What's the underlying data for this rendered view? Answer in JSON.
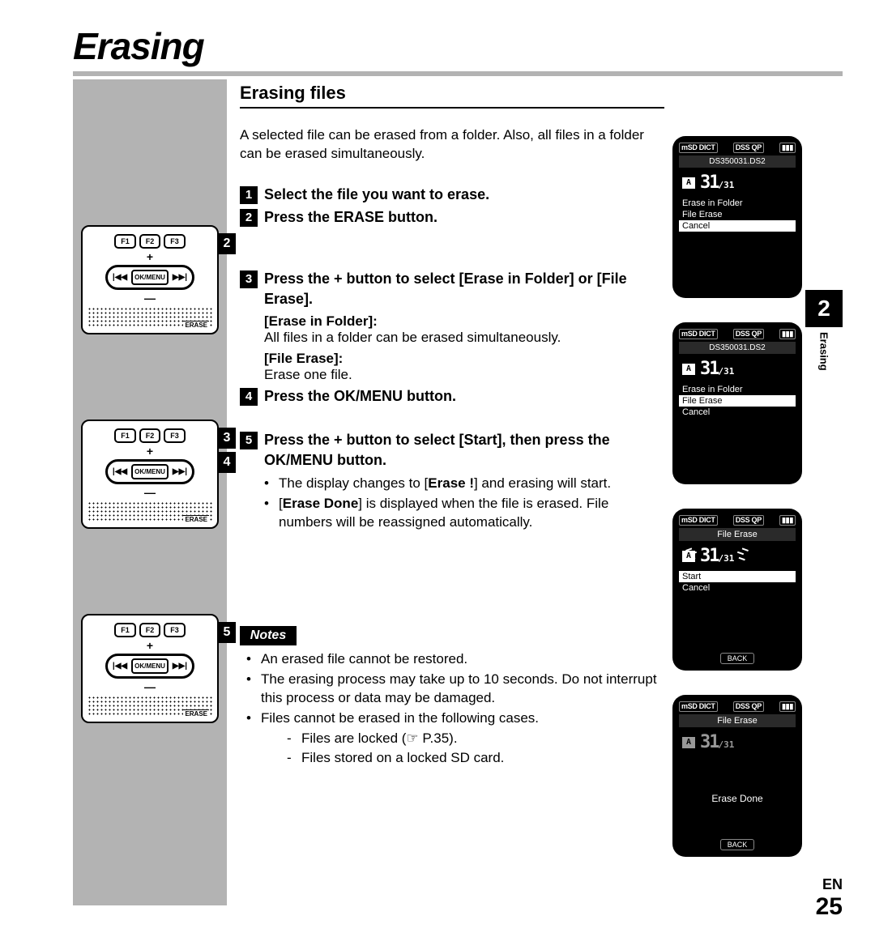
{
  "chapter_title": "Erasing",
  "section_title": "Erasing files",
  "intro": "A selected file can be erased from a folder. Also, all files in a folder can be erased simultaneously.",
  "steps": {
    "s1": "Select the file you want to erase.",
    "s2": "Press the ERASE button.",
    "s3": "Press the + button to select [Erase in Folder] or [File Erase].",
    "s3_sub1_label": "[Erase in Folder]:",
    "s3_sub1_text": "All files in a folder can be erased simultaneously.",
    "s3_sub2_label": "[File Erase]:",
    "s3_sub2_text": "Erase one file.",
    "s4": "Press the OK/MENU button.",
    "s5": "Press the + button to select [Start], then press the OK/MENU button.",
    "s5_b1_pre": "The display changes to [",
    "s5_b1_bold": "Erase !",
    "s5_b1_post": "] and erasing will start.",
    "s5_b2_pre": "[",
    "s5_b2_bold": "Erase Done",
    "s5_b2_post": "] is displayed when the file is erased. File numbers will be reassigned automatically."
  },
  "notes_label": "Notes",
  "notes": {
    "n1": "An erased file cannot be restored.",
    "n2": "The erasing process may take up to 10 seconds. Do not interrupt this process or data may be damaged.",
    "n3": "Files cannot be erased in the following cases.",
    "n3a": "Files are locked (☞ P.35).",
    "n3b": "Files stored on a locked SD card."
  },
  "device": {
    "f1": "F1",
    "f2": "F2",
    "f3": "F3",
    "rew": "|◀◀",
    "okmenu": "OK/MENU",
    "ff": "▶▶|",
    "plus": "+",
    "minus": "—",
    "erase": "ERASE"
  },
  "screens": {
    "status_left": "mSD DICT",
    "status_mid": "DSS QP",
    "filename": "DS350031.DS2",
    "folder_letter": "A",
    "count_big": "31",
    "count_small": "/31",
    "opt_erase_folder": "Erase in Folder",
    "opt_file_erase": "File Erase",
    "opt_cancel": "Cancel",
    "title_file_erase": "File Erase",
    "opt_start": "Start",
    "back": "BACK",
    "erase_done": "Erase Done"
  },
  "side_tab": {
    "num": "2",
    "label": "Erasing"
  },
  "footer": {
    "lang": "EN",
    "page": "25"
  }
}
